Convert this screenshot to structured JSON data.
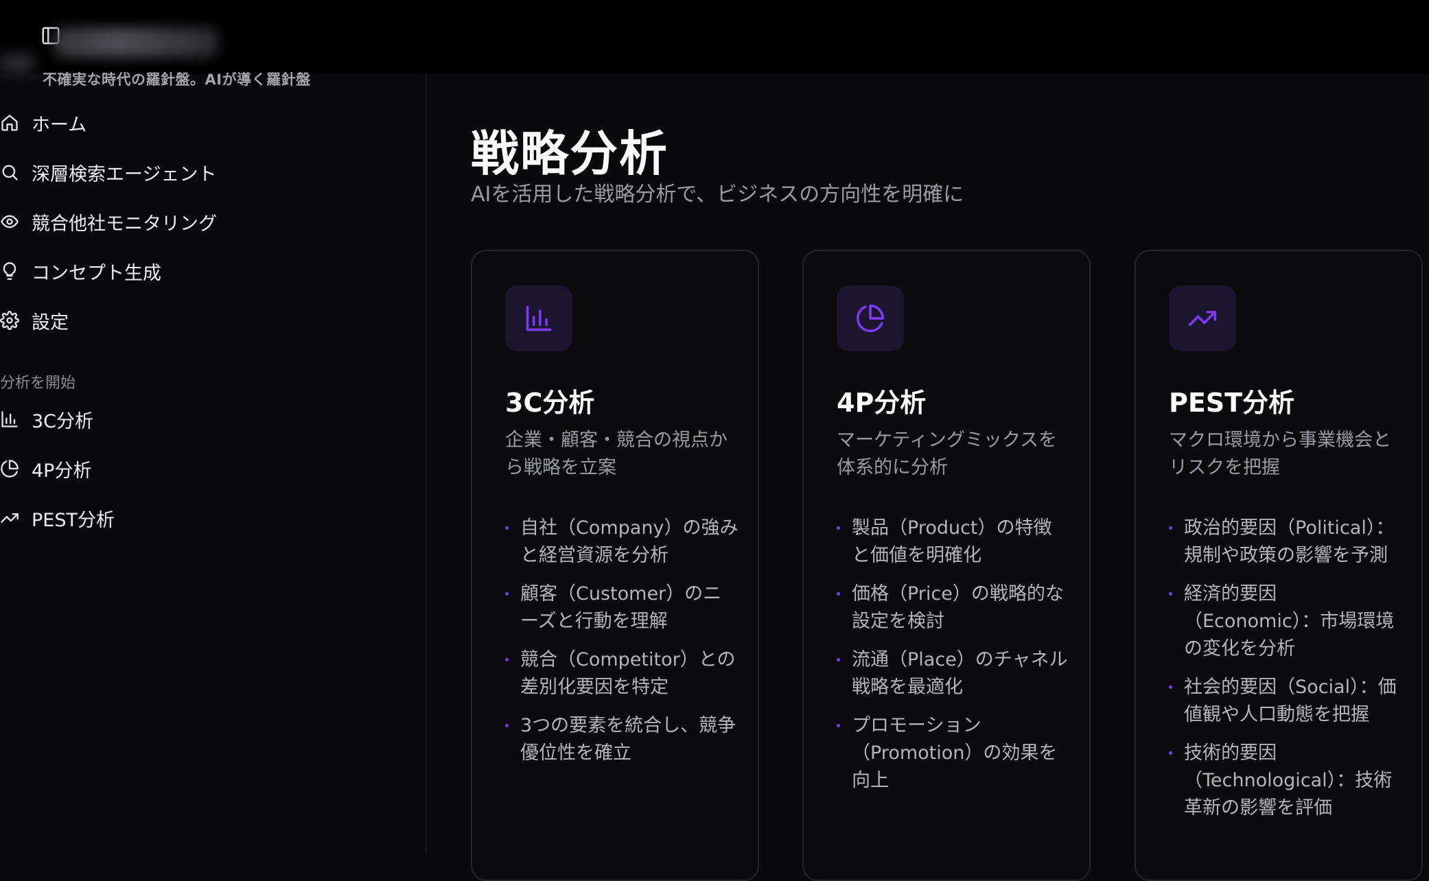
{
  "header": {
    "tagline": "不確実な時代の羅針盤。AIが導く羅針盤"
  },
  "sidebar": {
    "nav": [
      {
        "label": "ホーム",
        "icon": "home-icon"
      },
      {
        "label": "深層検索エージェント",
        "icon": "search-icon"
      },
      {
        "label": "競合他社モニタリング",
        "icon": "eye-icon"
      },
      {
        "label": "コンセプト生成",
        "icon": "lightbulb-icon"
      },
      {
        "label": "設定",
        "icon": "gear-icon"
      }
    ],
    "section_label": "分析を開始",
    "analysis": [
      {
        "label": "3C分析",
        "icon": "bar-chart-icon"
      },
      {
        "label": "4P分析",
        "icon": "pie-chart-icon"
      },
      {
        "label": "PEST分析",
        "icon": "trending-up-icon"
      }
    ]
  },
  "main": {
    "title": "戦略分析",
    "subtitle": "AIを活用した戦略分析で、ビジネスの方向性を明確に",
    "accent": "#7c3aed",
    "cards": [
      {
        "title": "3C分析",
        "icon": "bar-chart-icon",
        "description": "企業・顧客・競合の視点から戦略を立案",
        "points": [
          "自社（Company）の強みと経営資源を分析",
          "顧客（Customer）のニーズと行動を理解",
          "競合（Competitor）との差別化要因を特定",
          "3つの要素を統合し、競争優位性を確立"
        ]
      },
      {
        "title": "4P分析",
        "icon": "pie-chart-icon",
        "description": "マーケティングミックスを体系的に分析",
        "points": [
          "製品（Product）の特徴と価値を明確化",
          "価格（Price）の戦略的な設定を検討",
          "流通（Place）のチャネル戦略を最適化",
          "プロモーション（Promotion）の効果を向上"
        ]
      },
      {
        "title": "PEST分析",
        "icon": "trending-up-icon",
        "description": "マクロ環境から事業機会とリスクを把握",
        "points": [
          "政治的要因（Political）：規制や政策の影響を予測",
          "経済的要因（Economic）：市場環境の変化を分析",
          "社会的要因（Social）：価値観や人口動態を把握",
          "技術的要因（Technological）：技術革新の影響を評価"
        ]
      }
    ]
  }
}
